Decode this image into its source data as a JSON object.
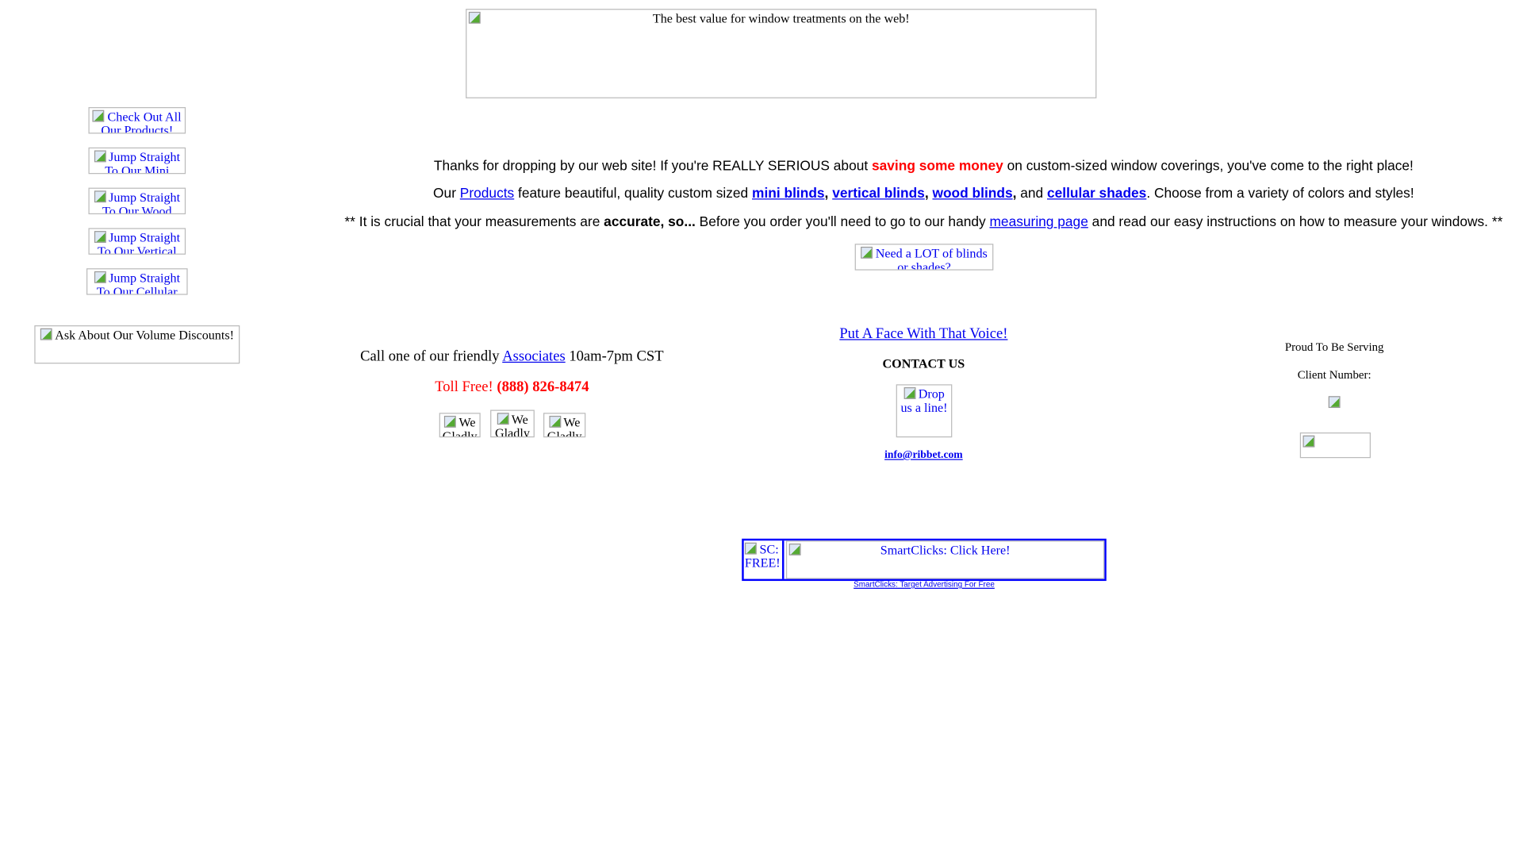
{
  "header": {
    "banner_alt": "The best value for window treatments on the web!"
  },
  "sidebar": {
    "items": [
      {
        "label": "Check Out All Our Products!"
      },
      {
        "label": "Jump Straight To Our Mini"
      },
      {
        "label": "Jump Straight To Our Wood"
      },
      {
        "label": "Jump Straight To Our Vertical"
      },
      {
        "label": "Jump Straight To Our Cellular"
      }
    ],
    "volume_discounts": "Ask About Our Volume Discounts!"
  },
  "intro": {
    "line1_a": "Thanks for dropping by our web site!  If you're REALLY SERIOUS about ",
    "line1_highlight": "saving some money",
    "line1_b": " on custom-sized window coverings, you've come to the right place!",
    "line2_a": "Our ",
    "line2_products": "Products",
    "line2_b": " feature beautiful, quality custom sized ",
    "mini": "mini blinds",
    "vertical": "vertical blinds",
    "wood": "wood blinds",
    "cellular": "cellular shades",
    "comma": ",",
    "and": " and ",
    "line2_c": ".  Choose from a variety of colors and styles!",
    "line3_a": "** It is crucial that your measurements are ",
    "line3_bold": "accurate, so...",
    "line3_b": "  Before you order you'll need to go to our handy ",
    "line3_link": "measuring page",
    "line3_c": " and read our easy instructions on how to measure your windows. **",
    "need_lot": "Need a LOT of blinds or shades?"
  },
  "call": {
    "text_a": "Call one of our friendly ",
    "associates": "Associates",
    "text_b": " 10am-7pm CST",
    "toll_label": "Toll Free! ",
    "phone": "(888) 826-8474",
    "cards": [
      "We Gladly",
      "We Gladly",
      "We Gladly"
    ]
  },
  "contact": {
    "face_link": "Put A Face With That Voice!",
    "heading": "CONTACT US",
    "drop_line": "Drop us a line!",
    "email": "info@ribbet.com"
  },
  "serving": {
    "line1": "Proud To Be Serving",
    "line2": "Client Number:"
  },
  "ad": {
    "sc_free": "SC: FREE!",
    "click_here": "SmartClicks: Click Here!",
    "footer_link": "SmartClicks: Target Advertising For Free",
    "border_color": "#0000ff"
  },
  "colors": {
    "link": "#0000ee",
    "highlight": "#ff0000"
  }
}
